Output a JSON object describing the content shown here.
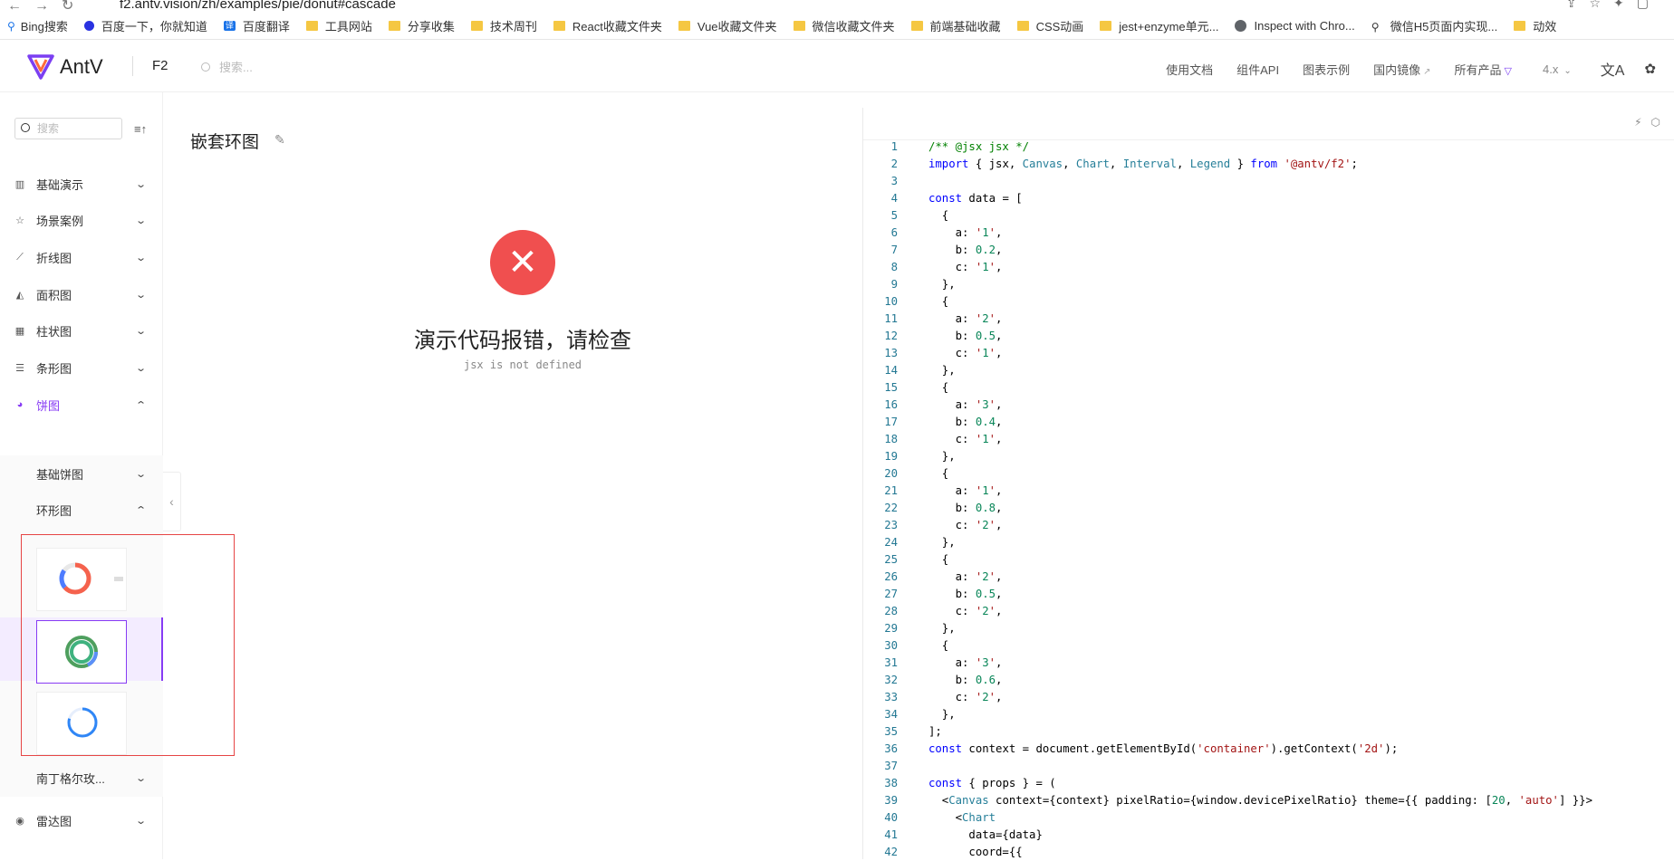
{
  "browser": {
    "url": "f2.antv.vision/zh/examples/pie/donut#cascade",
    "bookmarks": [
      {
        "label": "Bing搜索",
        "kind": "bing"
      },
      {
        "label": "百度一下，你就知道",
        "kind": "paw"
      },
      {
        "label": "百度翻译",
        "kind": "translate"
      },
      {
        "label": "工具网站",
        "kind": "folder"
      },
      {
        "label": "分享收集",
        "kind": "folder"
      },
      {
        "label": "技术周刊",
        "kind": "folder"
      },
      {
        "label": "React收藏文件夹",
        "kind": "folder"
      },
      {
        "label": "Vue收藏文件夹",
        "kind": "folder"
      },
      {
        "label": "微信收藏文件夹",
        "kind": "folder"
      },
      {
        "label": "前端基础收藏",
        "kind": "folder"
      },
      {
        "label": "CSS动画",
        "kind": "folder"
      },
      {
        "label": "jest+enzyme单元...",
        "kind": "folder"
      },
      {
        "label": "Inspect with Chro...",
        "kind": "globe"
      },
      {
        "label": "微信H5页面内实现...",
        "kind": "link"
      },
      {
        "label": "动效",
        "kind": "folder"
      }
    ]
  },
  "header": {
    "logo": "AntV",
    "product": "F2",
    "search_placeholder": "搜索...",
    "nav": [
      "使用文档",
      "组件API",
      "图表示例",
      "国内镜像",
      "所有产品",
      "4.x"
    ]
  },
  "sidebar": {
    "search_placeholder": "搜索",
    "items": [
      {
        "label": "基础演示",
        "icon": "bar-chart-icon"
      },
      {
        "label": "场景案例",
        "icon": "star-icon"
      },
      {
        "label": "折线图",
        "icon": "line-chart-icon"
      },
      {
        "label": "面积图",
        "icon": "area-chart-icon"
      },
      {
        "label": "柱状图",
        "icon": "column-chart-icon"
      },
      {
        "label": "条形图",
        "icon": "bar-horizontal-icon"
      },
      {
        "label": "饼图",
        "icon": "pie-chart-icon"
      }
    ],
    "sub_items": [
      "基础饼图",
      "环形图"
    ],
    "next_sub": "南丁格尔玫...",
    "after_item": "雷达图"
  },
  "preview": {
    "title": "嵌套环图",
    "error_title": "演示代码报错，请检查",
    "error_message": "jsx is not defined"
  },
  "colors": {
    "accent": "#873bf4",
    "error": "#f04f4f",
    "highlight_box": "#e64545"
  },
  "code_lines": [
    "/** @jsx jsx */",
    "import { jsx, Canvas, Chart, Interval, Legend } from '@antv/f2';",
    "",
    "const data = [",
    "  {",
    "    a: '1',",
    "    b: 0.2,",
    "    c: '1',",
    "  },",
    "  {",
    "    a: '2',",
    "    b: 0.5,",
    "    c: '1',",
    "  },",
    "  {",
    "    a: '3',",
    "    b: 0.4,",
    "    c: '1',",
    "  },",
    "  {",
    "    a: '1',",
    "    b: 0.8,",
    "    c: '2',",
    "  },",
    "  {",
    "    a: '2',",
    "    b: 0.5,",
    "    c: '2',",
    "  },",
    "  {",
    "    a: '3',",
    "    b: 0.6,",
    "    c: '2',",
    "  },",
    "];",
    "const context = document.getElementById('container').getContext('2d');",
    "",
    "const { props } = (",
    "  <Canvas context={context} pixelRatio={window.devicePixelRatio} theme={{ padding: [20, 'auto'] }}>",
    "    <Chart",
    "      data={data}",
    "      coord={{"
  ]
}
